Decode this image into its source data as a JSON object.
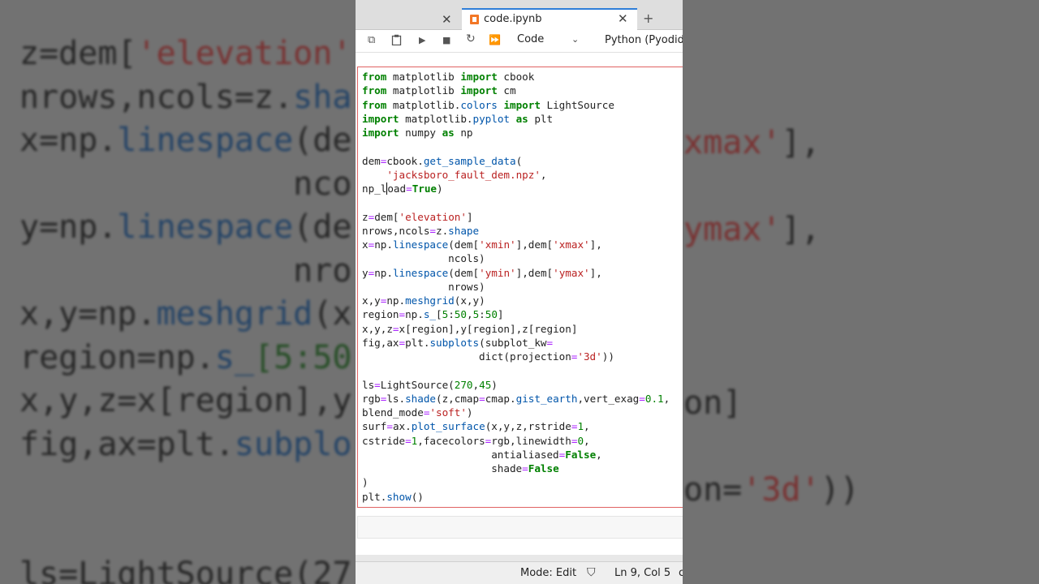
{
  "background": {
    "left_lines": [
      [
        {
          "t": "z=dem[",
          "c": "g"
        },
        {
          "t": "'elevation'",
          "c": "s"
        }
      ],
      [
        {
          "t": "nrows,ncols=z.",
          "c": "g"
        },
        {
          "t": "sha",
          "c": "f"
        }
      ],
      [
        {
          "t": "x=np.",
          "c": "g"
        },
        {
          "t": "linespace",
          "c": "f"
        },
        {
          "t": "(de",
          "c": "g"
        }
      ],
      [
        {
          "t": "              nco",
          "c": "g"
        }
      ],
      [
        {
          "t": "y=np.",
          "c": "g"
        },
        {
          "t": "linespace",
          "c": "f"
        },
        {
          "t": "(de",
          "c": "g"
        }
      ],
      [
        {
          "t": "              nro",
          "c": "g"
        }
      ],
      [
        {
          "t": "x,y=np.",
          "c": "g"
        },
        {
          "t": "meshgrid",
          "c": "f"
        },
        {
          "t": "(x",
          "c": "g"
        }
      ],
      [
        {
          "t": "region=np.",
          "c": "g"
        },
        {
          "t": "s_",
          "c": "f"
        },
        {
          "t": "[5:50",
          "c": "n"
        }
      ],
      [
        {
          "t": "x,y,z=x[region],y",
          "c": "g"
        }
      ],
      [
        {
          "t": "fig,ax=plt.",
          "c": "g"
        },
        {
          "t": "subplo",
          "c": "f"
        }
      ],
      [
        {
          "t": " ",
          "c": "g"
        }
      ],
      [
        {
          "t": " ",
          "c": "g"
        }
      ],
      [
        {
          "t": "ls=LightSource(27",
          "c": "g"
        }
      ]
    ],
    "right_lines": [
      [
        {
          "t": "xmax'",
          "c": "s"
        },
        {
          "t": "],",
          "c": "g"
        }
      ],
      [
        {
          "t": " ",
          "c": "g"
        }
      ],
      [
        {
          "t": "ymax'",
          "c": "s"
        },
        {
          "t": "],",
          "c": "g"
        }
      ],
      [
        {
          "t": " ",
          "c": "g"
        }
      ],
      [
        {
          "t": " ",
          "c": "g"
        }
      ],
      [
        {
          "t": " ",
          "c": "g"
        }
      ],
      [
        {
          "t": "on]",
          "c": "g"
        }
      ],
      [
        {
          "t": " ",
          "c": "g"
        }
      ],
      [
        {
          "t": "on=",
          "c": "g"
        },
        {
          "t": "'3d'",
          "c": "s"
        },
        {
          "t": "))",
          "c": "g"
        }
      ]
    ]
  },
  "tabs": {
    "prev_close": "✕",
    "active_title": "code.ipynb",
    "active_close": "✕",
    "add": "+"
  },
  "toolbar": {
    "copy_icon": "⧉",
    "paste_icon": "📋",
    "run_icon": "▶",
    "stop_icon": "■",
    "restart_icon": "↻",
    "run_all_icon": "⏩",
    "cell_type": "Code",
    "cell_type_chevron": "⌄",
    "kernel": "Python (Pyodide)"
  },
  "code_lines": [
    [
      {
        "t": "from",
        "c": "kw"
      },
      {
        "t": " matplotlib "
      },
      {
        "t": "import",
        "c": "kw"
      },
      {
        "t": " cbook"
      }
    ],
    [
      {
        "t": "from",
        "c": "kw"
      },
      {
        "t": " matplotlib "
      },
      {
        "t": "import",
        "c": "kw"
      },
      {
        "t": " cm"
      }
    ],
    [
      {
        "t": "from",
        "c": "kw"
      },
      {
        "t": " matplotlib."
      },
      {
        "t": "colors",
        "c": "at"
      },
      {
        "t": " "
      },
      {
        "t": "import",
        "c": "kw"
      },
      {
        "t": " LightSource"
      }
    ],
    [
      {
        "t": "import",
        "c": "kw"
      },
      {
        "t": " matplotlib."
      },
      {
        "t": "pyplot",
        "c": "at"
      },
      {
        "t": " "
      },
      {
        "t": "as",
        "c": "kw"
      },
      {
        "t": " plt"
      }
    ],
    [
      {
        "t": "import",
        "c": "kw"
      },
      {
        "t": " numpy "
      },
      {
        "t": "as",
        "c": "kw"
      },
      {
        "t": " np"
      }
    ],
    [
      {
        "t": ""
      }
    ],
    [
      {
        "t": "dem"
      },
      {
        "t": "=",
        "c": "op"
      },
      {
        "t": "cbook."
      },
      {
        "t": "get_sample_data",
        "c": "at"
      },
      {
        "t": "("
      }
    ],
    [
      {
        "t": "    "
      },
      {
        "t": "'jacksboro_fault_dem.npz'",
        "c": "st"
      },
      {
        "t": ","
      }
    ],
    [
      {
        "t": "np_l"
      },
      {
        "t": "",
        "c": "cursor"
      },
      {
        "t": "oad"
      },
      {
        "t": "=",
        "c": "op"
      },
      {
        "t": "True",
        "c": "kw"
      },
      {
        "t": ")"
      }
    ],
    [
      {
        "t": ""
      }
    ],
    [
      {
        "t": "z"
      },
      {
        "t": "=",
        "c": "op"
      },
      {
        "t": "dem["
      },
      {
        "t": "'elevation'",
        "c": "st"
      },
      {
        "t": "]"
      }
    ],
    [
      {
        "t": "nrows,ncols"
      },
      {
        "t": "=",
        "c": "op"
      },
      {
        "t": "z."
      },
      {
        "t": "shape",
        "c": "at"
      }
    ],
    [
      {
        "t": "x"
      },
      {
        "t": "=",
        "c": "op"
      },
      {
        "t": "np."
      },
      {
        "t": "linespace",
        "c": "at"
      },
      {
        "t": "(dem["
      },
      {
        "t": "'xmin'",
        "c": "st"
      },
      {
        "t": "],dem["
      },
      {
        "t": "'xmax'",
        "c": "st"
      },
      {
        "t": "],"
      }
    ],
    [
      {
        "t": "              ncols)"
      }
    ],
    [
      {
        "t": "y"
      },
      {
        "t": "=",
        "c": "op"
      },
      {
        "t": "np."
      },
      {
        "t": "linespace",
        "c": "at"
      },
      {
        "t": "(dem["
      },
      {
        "t": "'ymin'",
        "c": "st"
      },
      {
        "t": "],dem["
      },
      {
        "t": "'ymax'",
        "c": "st"
      },
      {
        "t": "],"
      }
    ],
    [
      {
        "t": "              nrows)"
      }
    ],
    [
      {
        "t": "x,y"
      },
      {
        "t": "=",
        "c": "op"
      },
      {
        "t": "np."
      },
      {
        "t": "meshgrid",
        "c": "at"
      },
      {
        "t": "(x,y)"
      }
    ],
    [
      {
        "t": "region"
      },
      {
        "t": "=",
        "c": "op"
      },
      {
        "t": "np."
      },
      {
        "t": "s_",
        "c": "at"
      },
      {
        "t": "["
      },
      {
        "t": "5",
        "c": "nm"
      },
      {
        "t": ":"
      },
      {
        "t": "50",
        "c": "nm"
      },
      {
        "t": ","
      },
      {
        "t": "5",
        "c": "nm"
      },
      {
        "t": ":"
      },
      {
        "t": "50",
        "c": "nm"
      },
      {
        "t": "]"
      }
    ],
    [
      {
        "t": "x,y,z"
      },
      {
        "t": "=",
        "c": "op"
      },
      {
        "t": "x[region],y[region],z[region]"
      }
    ],
    [
      {
        "t": "fig,ax"
      },
      {
        "t": "=",
        "c": "op"
      },
      {
        "t": "plt."
      },
      {
        "t": "subplots",
        "c": "at"
      },
      {
        "t": "(subplot_kw"
      },
      {
        "t": "=",
        "c": "op"
      }
    ],
    [
      {
        "t": "                   dict(projection"
      },
      {
        "t": "=",
        "c": "op"
      },
      {
        "t": "'3d'",
        "c": "st"
      },
      {
        "t": "))"
      }
    ],
    [
      {
        "t": ""
      }
    ],
    [
      {
        "t": "ls"
      },
      {
        "t": "=",
        "c": "op"
      },
      {
        "t": "LightSource("
      },
      {
        "t": "270",
        "c": "nm"
      },
      {
        "t": ","
      },
      {
        "t": "45",
        "c": "nm"
      },
      {
        "t": ")"
      }
    ],
    [
      {
        "t": "rgb"
      },
      {
        "t": "=",
        "c": "op"
      },
      {
        "t": "ls."
      },
      {
        "t": "shade",
        "c": "at"
      },
      {
        "t": "(z,cmap"
      },
      {
        "t": "=",
        "c": "op"
      },
      {
        "t": "cmap."
      },
      {
        "t": "gist_earth",
        "c": "at"
      },
      {
        "t": ",vert_exag"
      },
      {
        "t": "=",
        "c": "op"
      },
      {
        "t": "0.1",
        "c": "nm"
      },
      {
        "t": ","
      }
    ],
    [
      {
        "t": "blend_mode"
      },
      {
        "t": "=",
        "c": "op"
      },
      {
        "t": "'soft'",
        "c": "st"
      },
      {
        "t": ")"
      }
    ],
    [
      {
        "t": "surf"
      },
      {
        "t": "=",
        "c": "op"
      },
      {
        "t": "ax."
      },
      {
        "t": "plot_surface",
        "c": "at"
      },
      {
        "t": "(x,y,z,rstride"
      },
      {
        "t": "=",
        "c": "op"
      },
      {
        "t": "1",
        "c": "nm"
      },
      {
        "t": ","
      }
    ],
    [
      {
        "t": "cstride"
      },
      {
        "t": "=",
        "c": "op"
      },
      {
        "t": "1",
        "c": "nm"
      },
      {
        "t": ",facecolors"
      },
      {
        "t": "=",
        "c": "op"
      },
      {
        "t": "rgb,linewidth"
      },
      {
        "t": "=",
        "c": "op"
      },
      {
        "t": "0",
        "c": "nm"
      },
      {
        "t": ","
      }
    ],
    [
      {
        "t": "                     antialiased"
      },
      {
        "t": "=",
        "c": "op"
      },
      {
        "t": "False",
        "c": "kw"
      },
      {
        "t": ","
      }
    ],
    [
      {
        "t": "                     shade"
      },
      {
        "t": "=",
        "c": "op"
      },
      {
        "t": "False",
        "c": "kw"
      }
    ],
    [
      {
        "t": ")"
      }
    ],
    [
      {
        "t": "plt."
      },
      {
        "t": "show",
        "c": "at"
      },
      {
        "t": "()"
      }
    ]
  ],
  "status": {
    "mode": "Mode: Edit",
    "kernel_icon": "⛉",
    "position": "Ln 9, Col 5",
    "cut": "c"
  },
  "colors": {
    "active_tab_accent": "#2f7ed8",
    "active_cell_border": "#e06262",
    "keyword": "#008000",
    "string": "#ba2121",
    "attribute": "#0055aa"
  }
}
